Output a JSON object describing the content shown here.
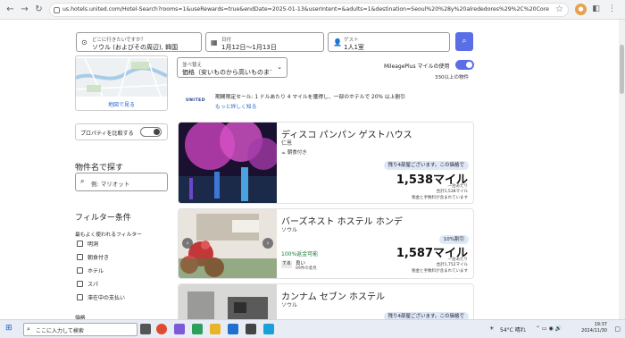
{
  "browser": {
    "url": "us.hotels.united.com/Hotel-Search?rooms=1&useRewards=true&endDate=2025-01-13&userIntent=&adults=1&destination=Seoul%20%28y%20alrededores%29%2C%20Corea%20del%20Sur&sort=PRICE_L..."
  },
  "search": {
    "destination_label": "どこに行きたいですか？",
    "destination_value": "ソウル (およびその周辺), 韓国",
    "date_label": "日付",
    "date_value": "1月12日～1月13日",
    "guest_label": "ゲスト",
    "guest_value": "1人1室"
  },
  "map": {
    "link": "地図で見る"
  },
  "sort": {
    "label": "並べ替え",
    "value": "価格（安いものから高いものまで）"
  },
  "miles": {
    "label": "MileagePlus マイルの使用",
    "count": "330以上の物件",
    "toggle_on": true
  },
  "promo": {
    "logo": "UNITED",
    "text": "期間限定セール: 1 ドルあたり 4 マイルを獲得し、一部のホテルで 20% 以上割引",
    "link": "もっと詳しく知る"
  },
  "sidebar": {
    "compare_label": "プロパティを比較する",
    "name_heading": "物件名で探す",
    "name_placeholder": "例: マリオット",
    "filter_heading": "フィルター条件",
    "popular_label": "最もよく使われるフィルター",
    "filters": [
      "明洞",
      "朝食付き",
      "ホテル",
      "スパ",
      "滞在中の支払い"
    ],
    "price_label": "価格"
  },
  "hotels": [
    {
      "name": "ディスコ パンパン ゲストハウス",
      "location": "仁恩",
      "amenity": "朝食付き",
      "badge": "残り4部屋ございます。この価格で",
      "price": "1,538マイル",
      "per_night": "一泊あたり",
      "total": "合計1,538マイル",
      "tax_note": "税金と手数料が含まれています"
    },
    {
      "name": "バーズネスト ホステル ホンデ",
      "location": "ソウル",
      "refundable": "100%返金可能",
      "rating": "7.6",
      "rating_word": "良い",
      "reviews": "89件の意見",
      "badge": "10%割引",
      "price": "1,587マイル",
      "per_night": "一泊あたり",
      "total": "合計1,752マイル",
      "tax_note": "税金と手数料が含まれています"
    },
    {
      "name": "カンナム セブン ホステル",
      "location": "ソウル",
      "badge": "残り4部屋ございます。この価格で"
    }
  ],
  "taskbar": {
    "search_placeholder": "ここに入力して検索",
    "weather": "54°C 晴れ",
    "time": "19:37",
    "date": "2024/11/30"
  }
}
